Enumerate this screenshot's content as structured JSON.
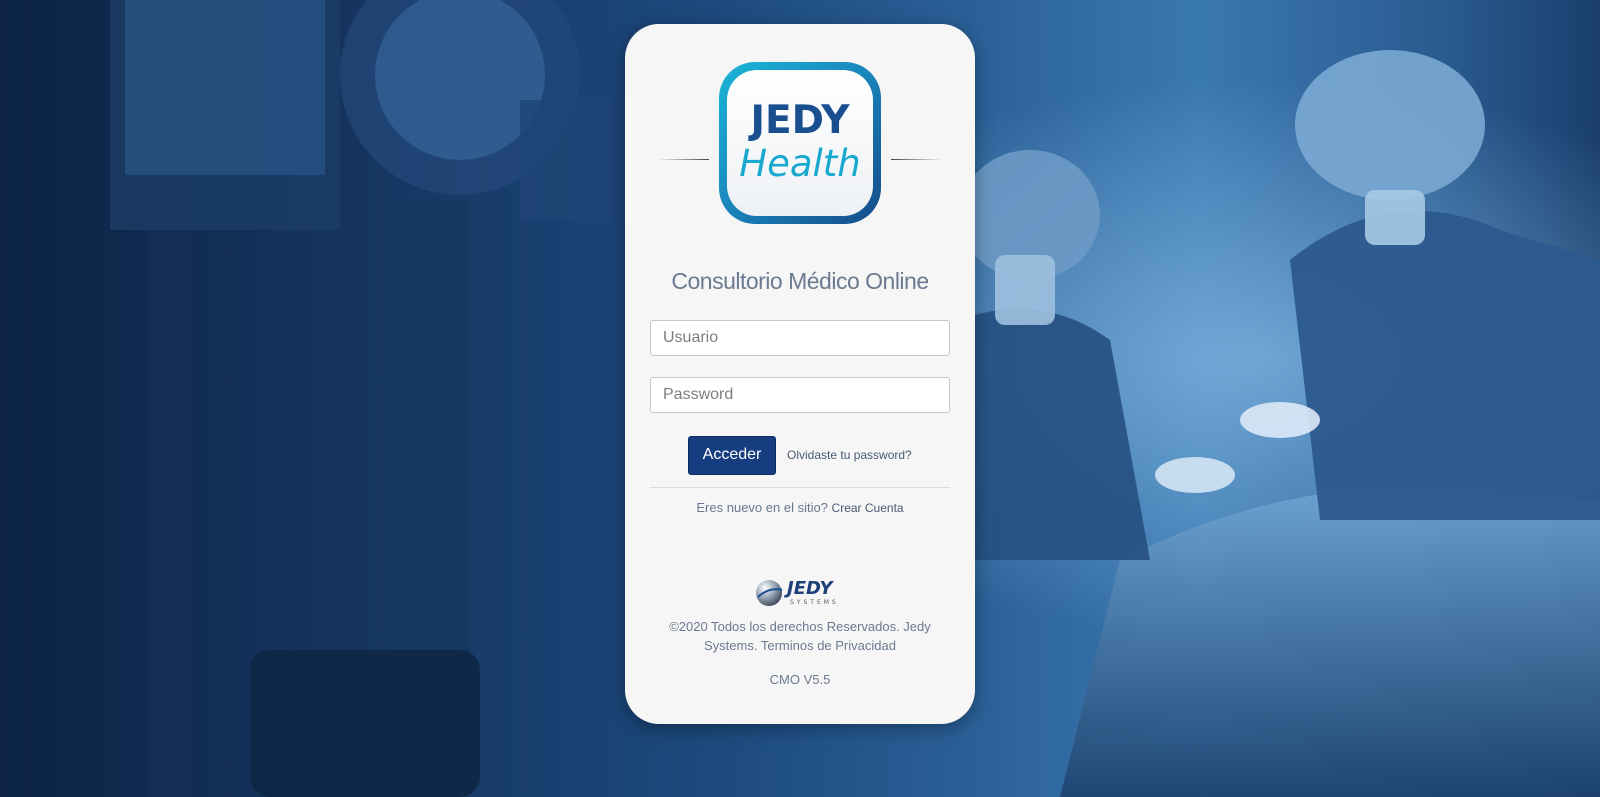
{
  "brand": {
    "logo_line1": "JEDY",
    "logo_line2": "Health",
    "footer_logo_text": "JEDY",
    "footer_logo_sub": "SYSTEMS"
  },
  "login": {
    "subtitle": "Consultorio Médico Online",
    "username_placeholder": "Usuario",
    "password_placeholder": "Password",
    "submit_label": "Acceder",
    "forgot_label": "Olvidaste tu password?",
    "new_site_text": "Eres nuevo en el sitio?",
    "create_account_label": "Crear Cuenta"
  },
  "footer": {
    "copyright": "©2020 Todos los derechos Reservados. Jedy Systems. Terminos de Privacidad",
    "version": "CMO V5.5"
  },
  "colors": {
    "primary_button": "#163d7f",
    "logo_blue": "#1a4f8f",
    "logo_cyan": "#19a9cf",
    "card_bg": "#f6f6f6",
    "text_muted": "#6b7a90"
  },
  "icons": {
    "background": "operating-room-photo",
    "footer_logo": "jedy-systems-logo"
  }
}
